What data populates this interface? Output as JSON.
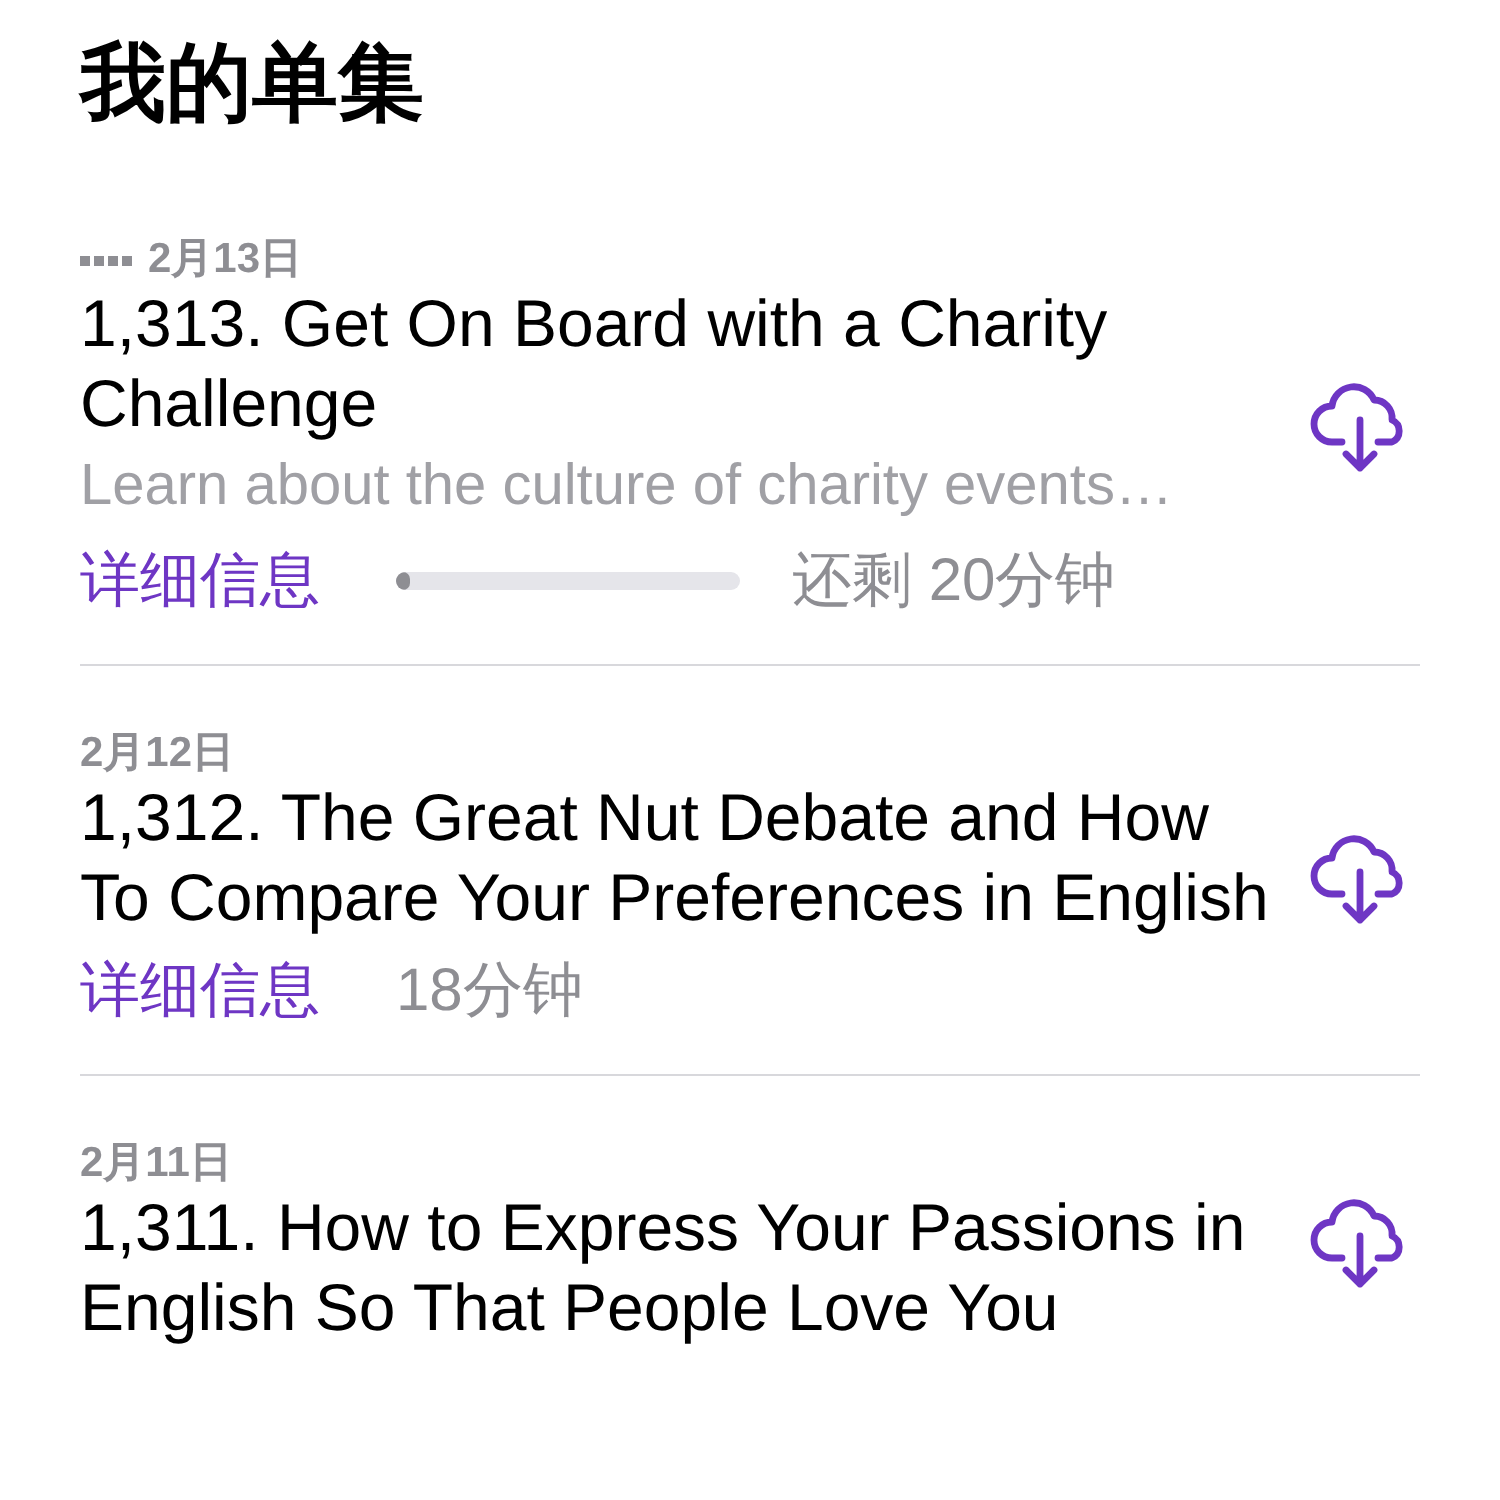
{
  "header": {
    "title": "我的单集"
  },
  "episodes": [
    {
      "date": "2月13日",
      "partial": true,
      "title": "1,313. Get On Board with a Charity Challenge",
      "description": "Learn about the culture of charity events…",
      "details_link": "详细信息",
      "progress": {
        "level": 0.04
      },
      "duration": "还剩 20分钟"
    },
    {
      "date": "2月12日",
      "partial": false,
      "title": "1,312. The Great Nut Debate and How To Compare Your Preferences in English",
      "details_link": "详细信息",
      "duration": "18分钟"
    },
    {
      "date": "2月11日",
      "partial": false,
      "title": "1,311. How to Express Your Passions in English So That People Love You"
    }
  ]
}
